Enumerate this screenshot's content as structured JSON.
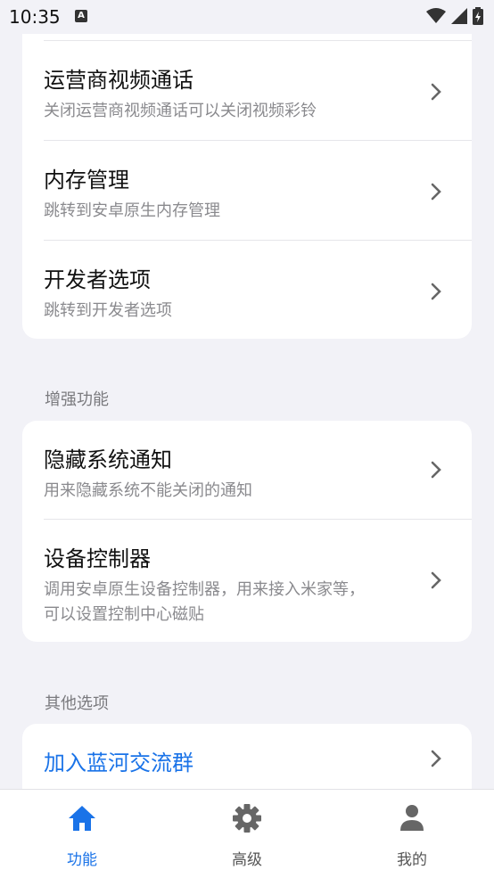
{
  "status": {
    "time": "10:35",
    "notif_glyph": "A"
  },
  "cards": {
    "system": [
      {
        "title": "运营商视频通话",
        "subtitle": "关闭运营商视频通话可以关闭视频彩铃"
      },
      {
        "title": "内存管理",
        "subtitle": "跳转到安卓原生内存管理"
      },
      {
        "title": "开发者选项",
        "subtitle": "跳转到开发者选项"
      }
    ],
    "enhanced_label": "增强功能",
    "enhanced": [
      {
        "title": "隐藏系统通知",
        "subtitle": "用来隐藏系统不能关闭的通知"
      },
      {
        "title": "设备控制器",
        "subtitle_line1": "调用安卓原生设备控制器，用来接入米家等，",
        "subtitle_line2": "可以设置控制中心磁贴"
      }
    ],
    "other_label": "其他选项",
    "other": [
      {
        "title": "加入蓝河交流群"
      }
    ]
  },
  "tabs": [
    {
      "label": "功能",
      "icon": "home-icon",
      "active": true
    },
    {
      "label": "高级",
      "icon": "gear-icon",
      "active": false
    },
    {
      "label": "我的",
      "icon": "person-icon",
      "active": false
    }
  ],
  "colors": {
    "accent": "#1a73e8",
    "inactive": "#666666",
    "background": "#f2f2f7"
  }
}
